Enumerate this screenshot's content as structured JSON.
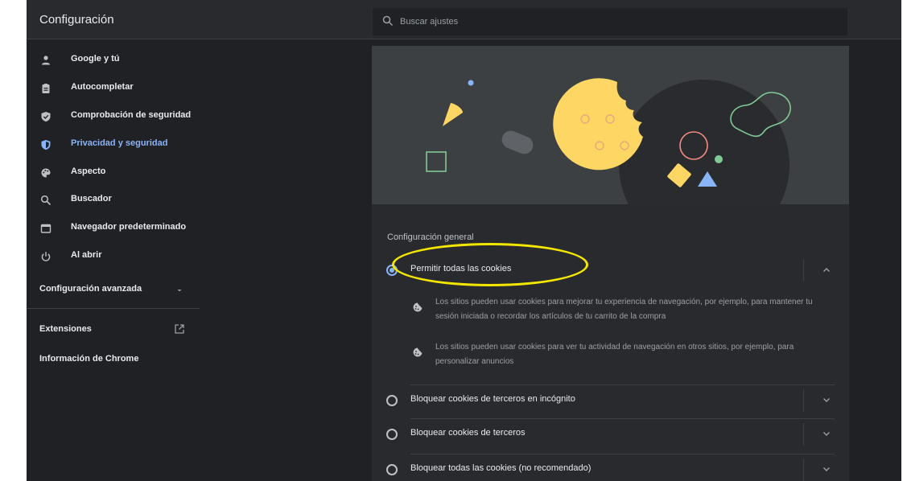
{
  "header": {
    "title": "Configuración",
    "search_placeholder": "Buscar ajustes",
    "search_icon": "search-icon"
  },
  "sidebar": {
    "items": [
      {
        "label": "Google y tú",
        "icon": "person-icon",
        "active": false
      },
      {
        "label": "Autocompletar",
        "icon": "clipboard-icon",
        "active": false
      },
      {
        "label": "Comprobación de seguridad",
        "icon": "shield-check-icon",
        "active": false
      },
      {
        "label": "Privacidad y seguridad",
        "icon": "shield-icon",
        "active": true
      },
      {
        "label": "Aspecto",
        "icon": "palette-icon",
        "active": false
      },
      {
        "label": "Buscador",
        "icon": "search-icon",
        "active": false
      },
      {
        "label": "Navegador predeterminado",
        "icon": "browser-icon",
        "active": false
      },
      {
        "label": "Al abrir",
        "icon": "power-icon",
        "active": false
      }
    ],
    "advanced_label": "Configuración avanzada",
    "extensions_label": "Extensiones",
    "about_label": "Información de Chrome"
  },
  "cookies": {
    "section_title": "Configuración general",
    "options": [
      {
        "label": "Permitir todas las cookies",
        "checked": true,
        "expanded": true
      },
      {
        "label": "Bloquear cookies de terceros en incógnito",
        "checked": false,
        "expanded": false
      },
      {
        "label": "Bloquear cookies de terceros",
        "checked": false,
        "expanded": false
      },
      {
        "label": "Bloquear todas las cookies (no recomendado)",
        "checked": false,
        "expanded": false
      }
    ],
    "details": [
      {
        "text": "Los sitios pueden usar cookies para mejorar tu experiencia de navegación, por ejemplo, para mantener tu sesión iniciada o recordar los artículos de tu carrito de la compra",
        "icon": "cookie-icon"
      },
      {
        "text": "Los sitios pueden usar cookies para ver tu actividad de navegación en otros sitios, por ejemplo, para personalizar anuncios",
        "icon": "cookie-icon"
      }
    ]
  },
  "colors": {
    "background": "#202124",
    "card": "#292a2d",
    "accent": "#8ab4f8",
    "highlight": "#f3e600",
    "cookie_yellow": "#fdd663"
  }
}
